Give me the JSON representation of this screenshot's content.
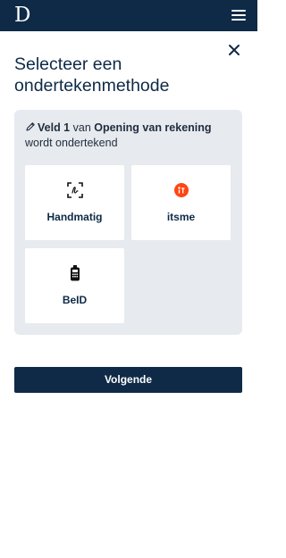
{
  "header": {
    "logo_letter": "D",
    "menu_icon": "hamburger-menu-icon"
  },
  "dialog": {
    "close_icon": "close-icon",
    "title": "Selecteer een ondertekenmethode",
    "info": {
      "icon": "pencil-icon",
      "field_label": "Veld 1",
      "from_text": " van ",
      "document_name": "Opening van rekening",
      "suffix_text": " wordt ondertekend"
    },
    "options": [
      {
        "label": "Handmatig",
        "icon": "handwritten-signature-icon"
      },
      {
        "label": "itsme",
        "icon": "itsme-logo-icon"
      },
      {
        "label": "BeID",
        "icon": "card-reader-icon"
      }
    ],
    "next_button_label": "Volgende"
  },
  "colors": {
    "navy": "#0e2a47",
    "panel_bg": "#e7eaee",
    "itsme_orange": "#ff4612"
  }
}
